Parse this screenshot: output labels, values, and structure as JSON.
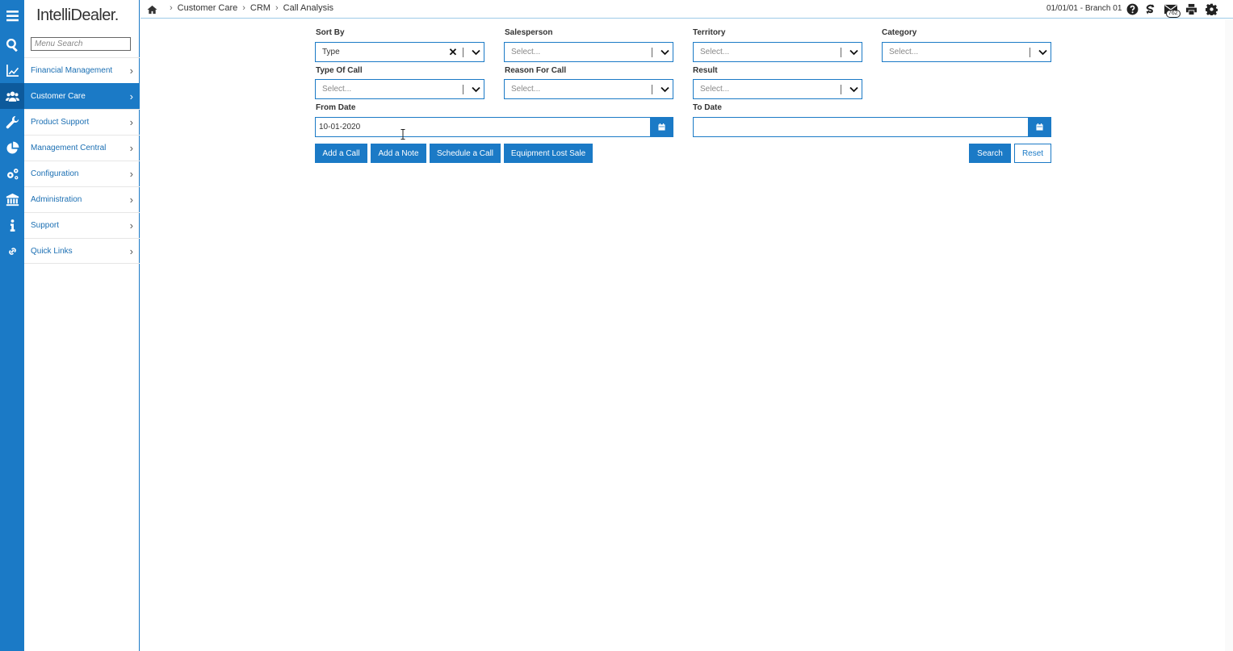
{
  "app": {
    "logo": "IntelliDealer",
    "logo_dot": "."
  },
  "menu": {
    "search_placeholder": "Menu Search",
    "items": [
      {
        "label": "Financial Management",
        "icon": "chart-line-icon"
      },
      {
        "label": "Customer Care",
        "icon": "users-icon",
        "active": true
      },
      {
        "label": "Product Support",
        "icon": "wrench-icon"
      },
      {
        "label": "Management Central",
        "icon": "pie-chart-icon"
      },
      {
        "label": "Configuration",
        "icon": "gears-icon"
      },
      {
        "label": "Administration",
        "icon": "bank-icon"
      },
      {
        "label": "Support",
        "icon": "info-icon"
      },
      {
        "label": "Quick Links",
        "icon": "link-icon"
      }
    ]
  },
  "topbar": {
    "breadcrumb": [
      "Customer Care",
      "CRM",
      "Call Analysis"
    ],
    "branch": "01/01/01 - Branch 01",
    "badge_count": "762"
  },
  "form": {
    "sort_by": {
      "label": "Sort By",
      "value": "Type"
    },
    "salesperson": {
      "label": "Salesperson",
      "placeholder": "Select..."
    },
    "territory": {
      "label": "Territory",
      "placeholder": "Select..."
    },
    "category": {
      "label": "Category",
      "placeholder": "Select..."
    },
    "type_of_call": {
      "label": "Type Of Call",
      "placeholder": "Select..."
    },
    "reason_for_call": {
      "label": "Reason For Call",
      "placeholder": "Select..."
    },
    "result": {
      "label": "Result",
      "placeholder": "Select..."
    },
    "from_date": {
      "label": "From Date",
      "value": "10-01-2020"
    },
    "to_date": {
      "label": "To Date",
      "value": ""
    }
  },
  "buttons": {
    "add_call": "Add a Call",
    "add_note": "Add a Note",
    "schedule_call": "Schedule a Call",
    "equipment_lost_sale": "Equipment Lost Sale",
    "search": "Search",
    "reset": "Reset"
  },
  "colors": {
    "primary": "#1b7ac6",
    "primary_dark": "#0d5a9c",
    "text": "#333333"
  }
}
